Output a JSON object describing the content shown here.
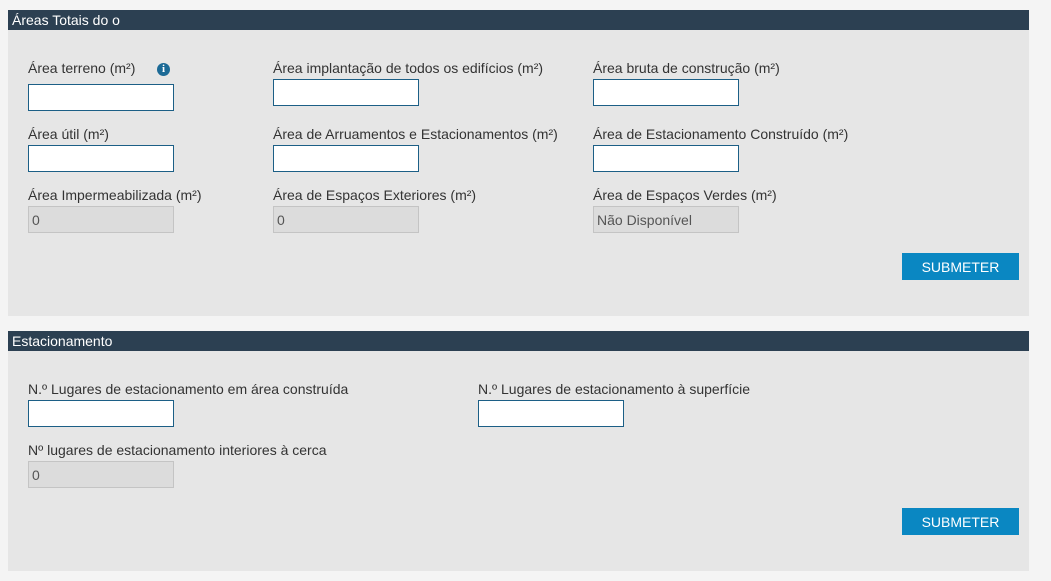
{
  "areas_section": {
    "title": "Áreas Totais do o",
    "fields": {
      "area_terreno": {
        "label": "Área terreno (m²)",
        "value": ""
      },
      "area_implantacao": {
        "label": "Área implantação de todos os edifícios (m²)",
        "value": ""
      },
      "area_bruta": {
        "label": "Área bruta de construção (m²)",
        "value": ""
      },
      "area_util": {
        "label": "Área útil (m²)",
        "value": ""
      },
      "area_arruamentos": {
        "label": "Área de Arruamentos e Estacionamentos (m²)",
        "value": ""
      },
      "area_estacionamento_construido": {
        "label": "Área de Estacionamento Construído (m²)",
        "value": ""
      },
      "area_impermeabilizada": {
        "label": "Área Impermeabilizada (m²)",
        "value": "0"
      },
      "area_espacos_exteriores": {
        "label": "Área de Espaços Exteriores (m²)",
        "value": "0"
      },
      "area_espacos_verdes": {
        "label": "Área de Espaços Verdes (m²)",
        "value": "Não Disponível"
      }
    },
    "info_icon": "info-icon",
    "submit_label": "SUBMETER"
  },
  "parking_section": {
    "title": "Estacionamento",
    "fields": {
      "lugares_construida": {
        "label": "N.º Lugares de estacionamento em área construída",
        "value": ""
      },
      "lugares_superficie": {
        "label": "N.º Lugares de estacionamento à superfície",
        "value": ""
      },
      "lugares_interiores": {
        "label": "Nº lugares de estacionamento interiores à cerca",
        "value": "0"
      }
    },
    "submit_label": "SUBMETER"
  },
  "colors": {
    "header_bg": "#2c4052",
    "panel_bg": "#e6e6e6",
    "button_bg": "#0a87c2",
    "input_border": "#1c5f86"
  }
}
